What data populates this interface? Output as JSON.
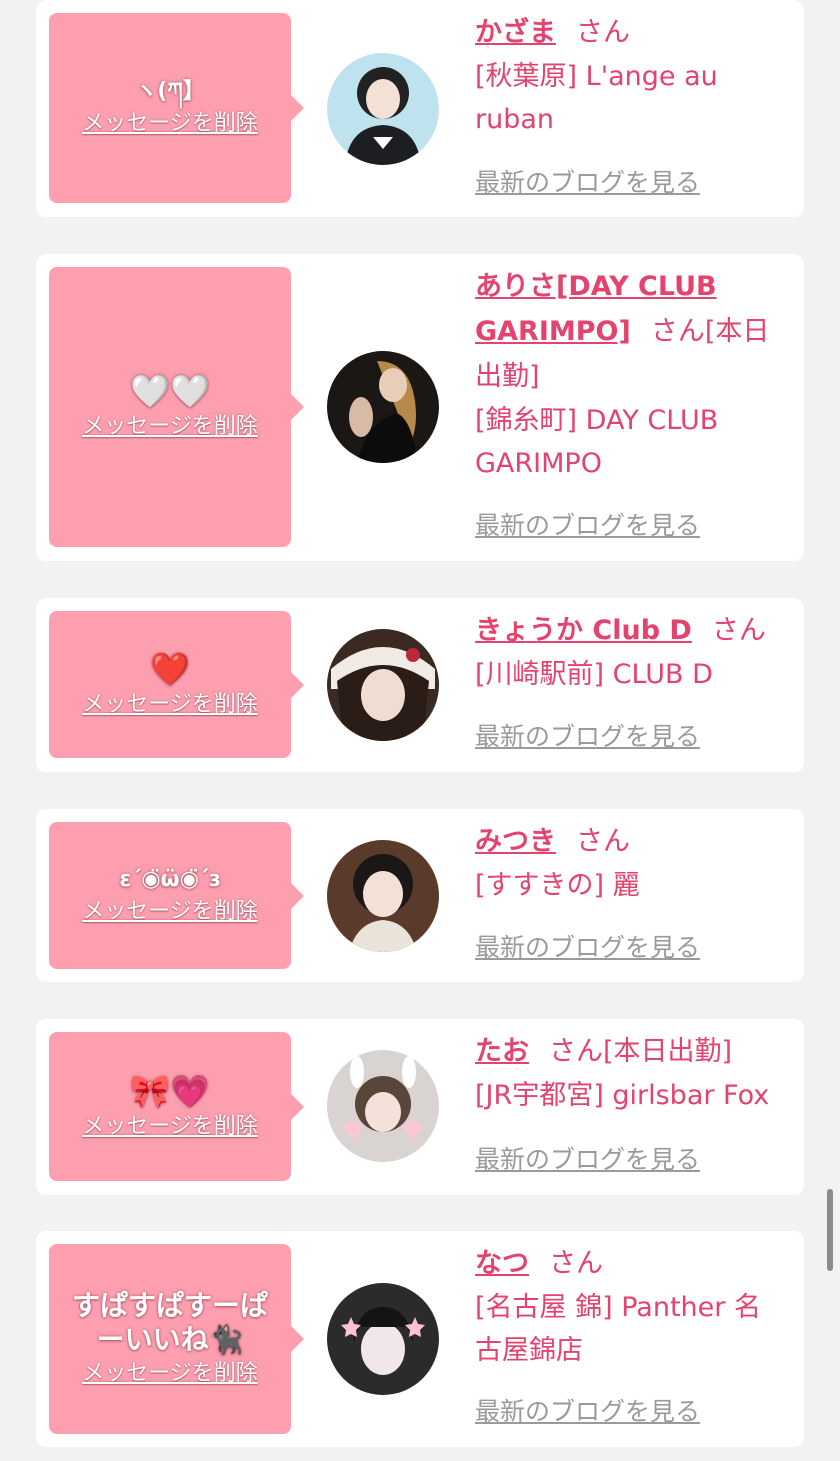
{
  "items": [
    {
      "message": "ヽ(ཀ】",
      "delete_label": "メッセージを削除",
      "name": "かざま",
      "honorific": "さん",
      "status": "",
      "shop": "[秋葉原] L'ange au ruban",
      "blog_label": "最新のブログを見る"
    },
    {
      "message": "🤍🤍",
      "delete_label": "メッセージを削除",
      "name": "ありさ[DAY CLUB GARIMPO]",
      "honorific": "さん",
      "status": "[本日出勤]",
      "shop": "[錦糸町] DAY CLUB GARIMPO",
      "blog_label": "最新のブログを見る"
    },
    {
      "message": "❤️",
      "delete_label": "メッセージを削除",
      "name": "きょうか Club D",
      "honorific": "さん",
      "status": "",
      "shop": "[川崎駅前] CLUB D",
      "blog_label": "最新のブログを見る"
    },
    {
      "message": "ε΄◉̈ω̈◉̈΄ɜ",
      "delete_label": "メッセージを削除",
      "name": "みつき",
      "honorific": "さん",
      "status": "",
      "shop": "[すすきの] 麗",
      "blog_label": "最新のブログを見る"
    },
    {
      "message": "🎀💗",
      "delete_label": "メッセージを削除",
      "name": "たお",
      "honorific": "さん",
      "status": "[本日出勤]",
      "shop": "[JR宇都宮] girlsbar Fox",
      "blog_label": "最新のブログを見る"
    },
    {
      "message": "すぱすぱすーぱーいいね🐈‍⬛",
      "delete_label": "メッセージを削除",
      "name": "なつ",
      "honorific": "さん",
      "status": "",
      "shop": "[名古屋 錦] Panther 名古屋錦店",
      "blog_label": "最新のブログを見る"
    }
  ],
  "colors": {
    "accent": "#e3436d",
    "bubble": "#fd9fae",
    "link_gray": "#9a9a9a",
    "background": "#f2f2f2"
  }
}
